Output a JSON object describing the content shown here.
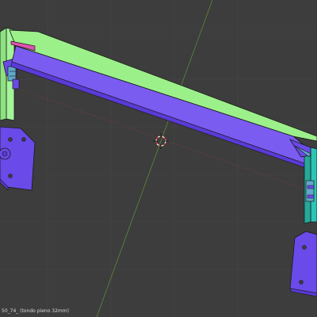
{
  "viewport": {
    "object_label": "50_74_ (tondo pieno 32mm)",
    "colors": {
      "background": "#3d3d3d",
      "grid_line": "#474747",
      "y_axis": "#5a8a3a",
      "x_axis": "#8a3a3a",
      "beam_top": "#9cf08a",
      "beam_front": "#7a5cf0",
      "beam_edge": "#5a3ad8",
      "plate": "#6a4ae8",
      "post_left": "#a4f49a",
      "post_right": "#2cc4b4",
      "hardware": "#5fa8c8",
      "accent": "#e050b0",
      "outline": "#1a1a1a"
    },
    "icons": [
      "3d-cursor-icon"
    ]
  }
}
